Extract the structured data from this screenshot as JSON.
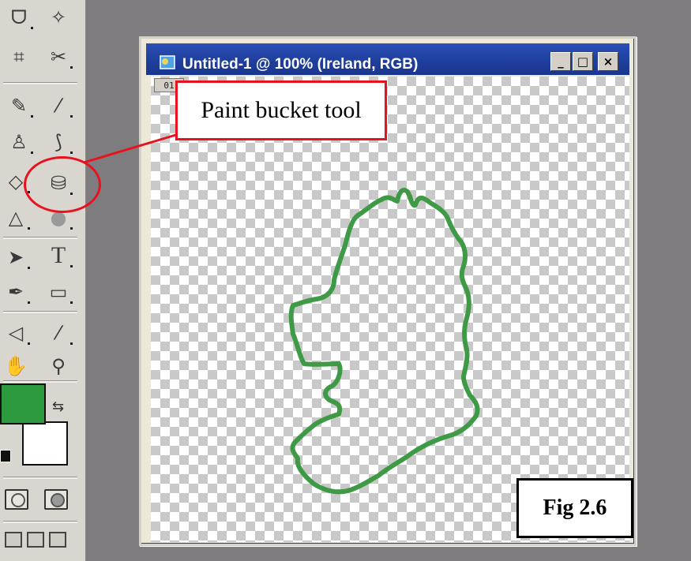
{
  "document_window": {
    "title": "Untitled-1 @ 100% (Ireland, RGB)",
    "tab_label": "01",
    "minimize_label": "_",
    "maximize_label": "□",
    "close_label": "×"
  },
  "callout": {
    "label": "Paint bucket tool"
  },
  "figure": {
    "label": "Fig 2.6"
  },
  "toolbox": {
    "tools": [
      {
        "name": "lasso-tool",
        "glyph": "ᗜ"
      },
      {
        "name": "magic-wand-tool",
        "glyph": "✧"
      },
      {
        "name": "crop-tool",
        "glyph": "⌗"
      },
      {
        "name": "slice-tool",
        "glyph": "✂"
      },
      {
        "name": "healing-brush-tool",
        "glyph": "✎"
      },
      {
        "name": "brush-tool",
        "glyph": "⁄"
      },
      {
        "name": "clone-stamp-tool",
        "glyph": "♙"
      },
      {
        "name": "history-brush-tool",
        "glyph": "⟆"
      },
      {
        "name": "eraser-tool",
        "glyph": "◇"
      },
      {
        "name": "paint-bucket-tool",
        "glyph": "⛁"
      },
      {
        "name": "blur-tool",
        "glyph": "△"
      },
      {
        "name": "dodge-tool",
        "glyph": "●"
      },
      {
        "name": "path-selection-tool",
        "glyph": "➤"
      },
      {
        "name": "type-tool",
        "glyph": "T"
      },
      {
        "name": "pen-tool",
        "glyph": "✒"
      },
      {
        "name": "shape-tool",
        "glyph": "▭"
      },
      {
        "name": "notes-tool",
        "glyph": "◁"
      },
      {
        "name": "eyedropper-tool",
        "glyph": "⁄"
      },
      {
        "name": "hand-tool",
        "glyph": "✋"
      },
      {
        "name": "zoom-tool",
        "glyph": "⚲"
      }
    ],
    "foreground_color": "#2e9a3e",
    "background_color": "#ffffff",
    "swap_glyph": "⇆"
  },
  "colors": {
    "callout_red": "#e8121e",
    "outline_green": "#3f9a46",
    "title_bar_blue": "#1f3f9c",
    "workspace_gray": "#7f7c80"
  }
}
